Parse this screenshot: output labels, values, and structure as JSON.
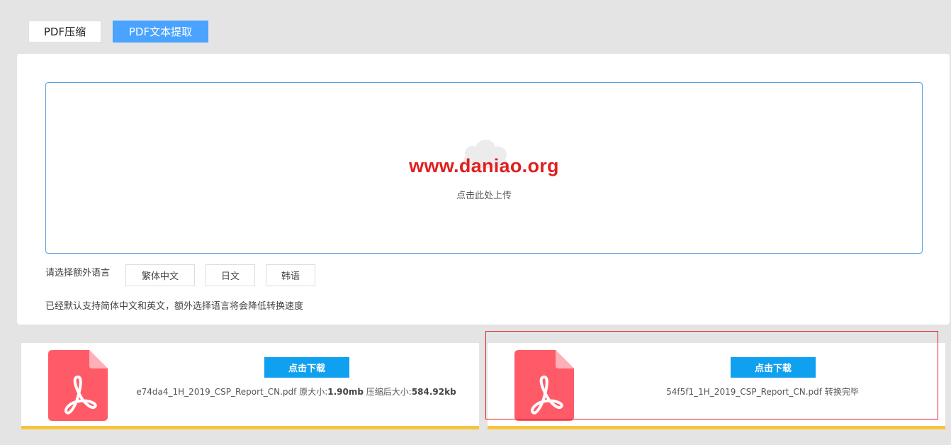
{
  "tabs": {
    "compress": "PDF压缩",
    "extract": "PDF文本提取"
  },
  "upload": {
    "watermark": "www.daniao.org",
    "hint": "点击此处上传"
  },
  "language": {
    "label": "请选择额外语言",
    "options": [
      "繁体中文",
      "日文",
      "韩语"
    ],
    "note": "已经默认支持简体中文和英文，额外选择语言将会降低转换速度"
  },
  "files": [
    {
      "download_label": "点击下载",
      "name": "e74da4_1H_2019_CSP_Report_CN.pdf",
      "orig_label": "原大小:",
      "orig_size": "1.90mb",
      "comp_label": "压缩后大小:",
      "comp_size": "584.92kb"
    },
    {
      "download_label": "点击下载",
      "name": "54f5f1_1H_2019_CSP_Report_CN.pdf",
      "status": "转换完毕"
    }
  ],
  "colors": {
    "accent": "#4aa3ff",
    "download": "#0fa0f0",
    "pdf_icon": "#ff5a67",
    "card_underline": "#f7c43b",
    "highlight": "#e0202a"
  }
}
